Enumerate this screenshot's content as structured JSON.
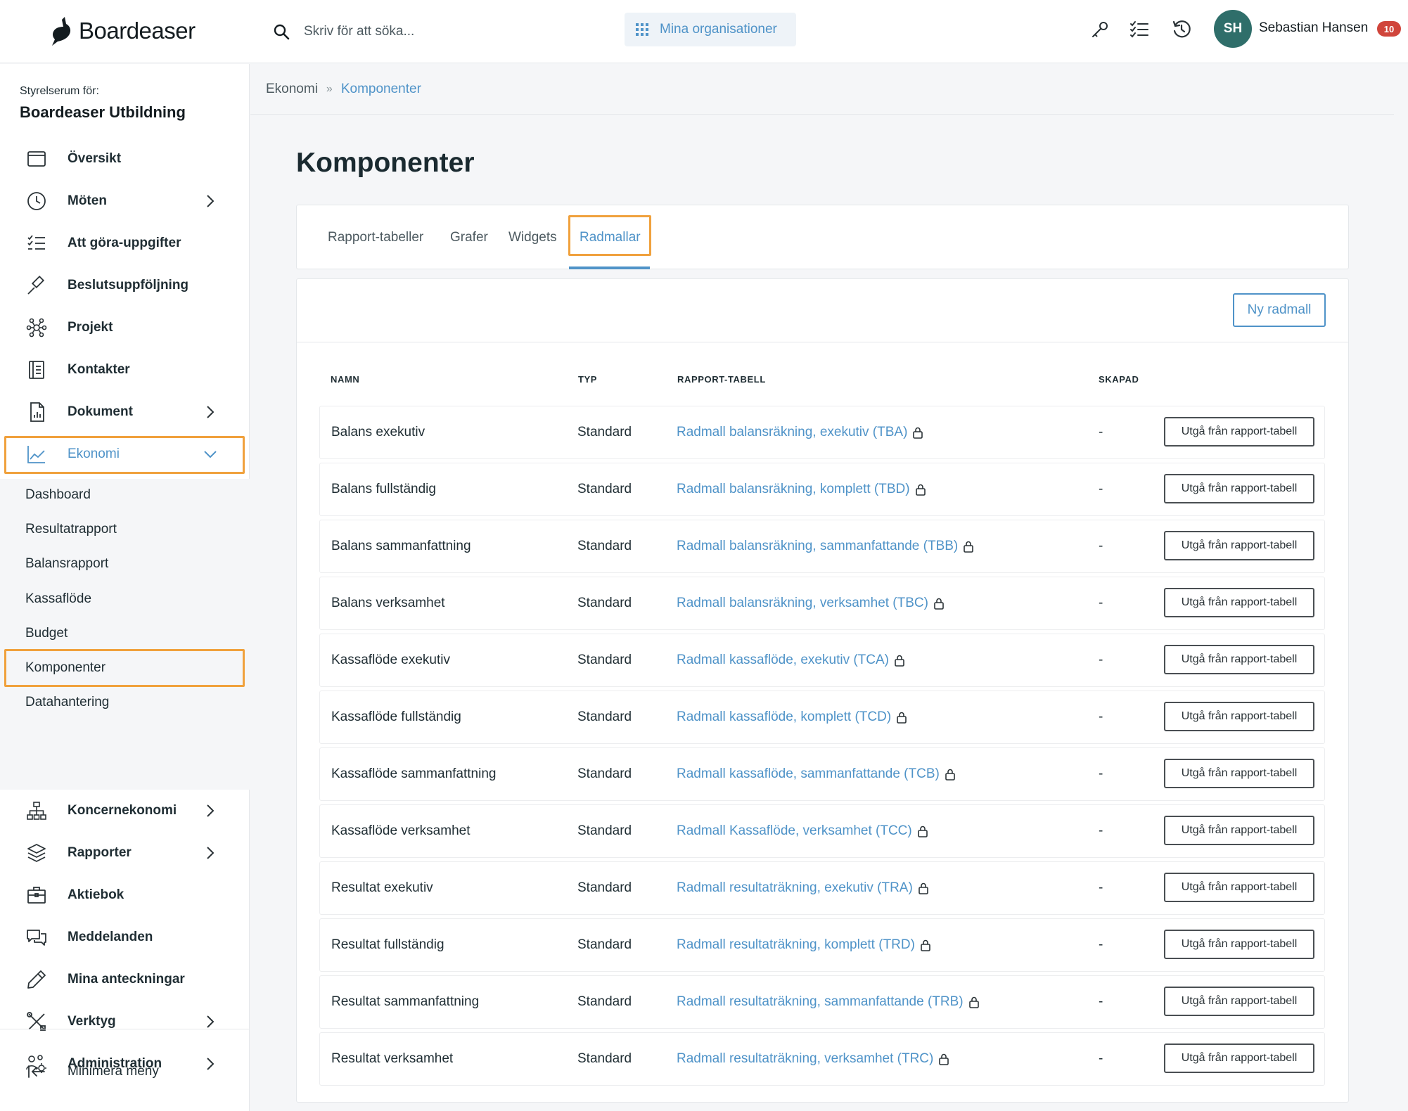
{
  "brand": {
    "name": "Boardeaser"
  },
  "search": {
    "placeholder": "Skriv för att söka..."
  },
  "header": {
    "org_button": "Mina organisationer",
    "user": {
      "initials": "SH",
      "name": "Sebastian Hansen",
      "badge": "10"
    },
    "icons": [
      "key-icon",
      "checklist-icon",
      "history-icon"
    ]
  },
  "sidebar": {
    "label": "Styrelserum för:",
    "org": "Boardeaser Utbildning",
    "items": [
      {
        "label": "Översikt"
      },
      {
        "label": "Möten"
      },
      {
        "label": "Att göra-uppgifter"
      },
      {
        "label": "Beslutsuppföljning"
      },
      {
        "label": "Projekt"
      },
      {
        "label": "Kontakter"
      },
      {
        "label": "Dokument"
      },
      {
        "label": "Ekonomi"
      }
    ],
    "sub_items": [
      {
        "label": "Dashboard"
      },
      {
        "label": "Resultatrapport"
      },
      {
        "label": "Balansrapport"
      },
      {
        "label": "Kassaflöde"
      },
      {
        "label": "Budget"
      },
      {
        "label": "Komponenter"
      },
      {
        "label": "Datahantering"
      }
    ],
    "items_after": [
      {
        "label": "Koncernekonomi"
      },
      {
        "label": "Rapporter"
      },
      {
        "label": "Aktiebok"
      },
      {
        "label": "Meddelanden"
      },
      {
        "label": "Mina anteckningar"
      },
      {
        "label": "Verktyg"
      },
      {
        "label": "Administration"
      }
    ],
    "minimize": "Minimera meny"
  },
  "breadcrumb": {
    "parent": "Ekonomi",
    "sep": "»",
    "current": "Komponenter"
  },
  "page": {
    "title": "Komponenter"
  },
  "tabs": [
    {
      "label": "Rapport-tabeller"
    },
    {
      "label": "Grafer"
    },
    {
      "label": "Widgets"
    },
    {
      "label": "Radmallar"
    }
  ],
  "table": {
    "new_button": "Ny radmall",
    "headers": {
      "name": "NAMN",
      "type": "TYP",
      "report": "RAPPORT-TABELL",
      "created": "SKAPAD"
    },
    "action_label": "Utgå från rapport-tabell",
    "rows": [
      {
        "name": "Balans exekutiv",
        "type": "Standard",
        "report": "Radmall balansräkning, exekutiv (TBA)",
        "created": "-"
      },
      {
        "name": "Balans fullständig",
        "type": "Standard",
        "report": "Radmall balansräkning, komplett (TBD)",
        "created": "-"
      },
      {
        "name": "Balans sammanfattning",
        "type": "Standard",
        "report": "Radmall balansräkning, sammanfattande (TBB)",
        "created": "-"
      },
      {
        "name": "Balans verksamhet",
        "type": "Standard",
        "report": "Radmall balansräkning, verksamhet (TBC)",
        "created": "-"
      },
      {
        "name": "Kassaflöde exekutiv",
        "type": "Standard",
        "report": "Radmall kassaflöde, exekutiv (TCA)",
        "created": "-"
      },
      {
        "name": "Kassaflöde fullständig",
        "type": "Standard",
        "report": "Radmall kassaflöde, komplett (TCD)",
        "created": "-"
      },
      {
        "name": "Kassaflöde sammanfattning",
        "type": "Standard",
        "report": "Radmall kassaflöde, sammanfattande (TCB)",
        "created": "-"
      },
      {
        "name": "Kassaflöde verksamhet",
        "type": "Standard",
        "report": "Radmall Kassaflöde, verksamhet (TCC)",
        "created": "-"
      },
      {
        "name": "Resultat exekutiv",
        "type": "Standard",
        "report": "Radmall resultaträkning, exekutiv (TRA)",
        "created": "-"
      },
      {
        "name": "Resultat fullständig",
        "type": "Standard",
        "report": "Radmall resultaträkning, komplett (TRD)",
        "created": "-"
      },
      {
        "name": "Resultat sammanfattning",
        "type": "Standard",
        "report": "Radmall resultaträkning, sammanfattande (TRB)",
        "created": "-"
      },
      {
        "name": "Resultat verksamhet",
        "type": "Standard",
        "report": "Radmall resultaträkning, verksamhet (TRC)",
        "created": "-"
      }
    ]
  },
  "colors": {
    "accent": "#4f93c8",
    "highlight": "#f0a13d",
    "avatar": "#2f6e6a",
    "badge": "#d0453b"
  }
}
